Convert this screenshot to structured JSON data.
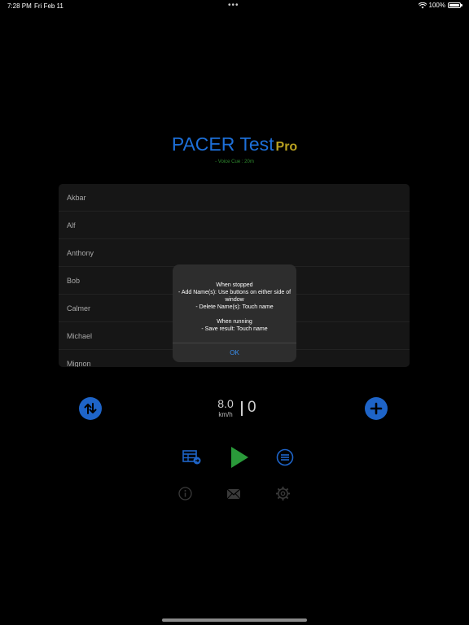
{
  "status_bar": {
    "time": "7:28 PM",
    "date": "Fri Feb 11",
    "dots": "•••",
    "battery": "100%"
  },
  "header": {
    "title": "PACER Test",
    "pro_badge": "Pro",
    "voice_cue": "- Voice Cue : 20m"
  },
  "names": [
    "Akbar",
    "Alf",
    "Anthony",
    "Bob",
    "Calmer",
    "Michael",
    "Mignon"
  ],
  "alert": {
    "running_heading_stopped": "When stopped",
    "line_add": "- Add Name(s): Use buttons on either side of window",
    "line_delete": "- Delete Name(s): Touch name",
    "running_heading": "When running",
    "line_save": "- Save result: Touch name",
    "ok_label": "OK"
  },
  "controls": {
    "speed": "8.0",
    "speed_unit": "km/h",
    "count": "0"
  },
  "colors": {
    "accent_blue": "#1e64c8",
    "title_blue": "#1d6fd8",
    "pro_gold": "#b8a020",
    "play_green": "#2a9a3a",
    "voice_green": "#2f8a2f",
    "link_blue": "#3a8ff0"
  }
}
